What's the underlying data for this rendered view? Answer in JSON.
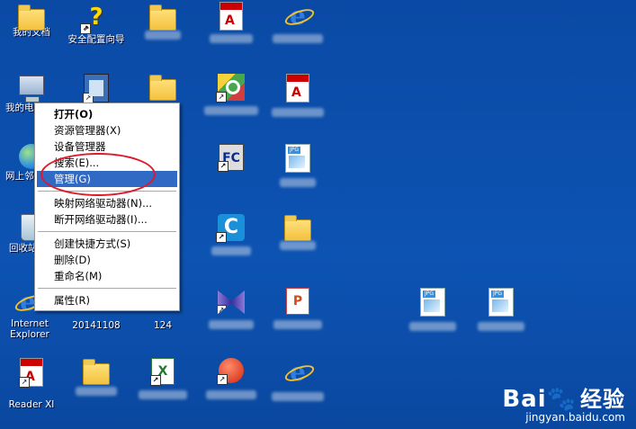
{
  "desktop": {
    "icons": [
      {
        "label": "我的文档"
      },
      {
        "label": "安全配置向导"
      },
      {
        "label": "网上邻居"
      },
      {
        "label": "回收站"
      },
      {
        "label": "Internet Explorer"
      },
      {
        "label": "20141108"
      },
      {
        "label": "124"
      },
      {
        "label": "Reader XI"
      },
      {
        "label": "我的电脑"
      }
    ]
  },
  "context_menu": {
    "items": [
      {
        "label": "打开(O)"
      },
      {
        "label": "资源管理器(X)"
      },
      {
        "label": "设备管理器"
      },
      {
        "label": "搜索(E)..."
      },
      {
        "label": "管理(G)"
      },
      {
        "label": "映射网络驱动器(N)..."
      },
      {
        "label": "断开网络驱动器(I)..."
      },
      {
        "label": "创建快捷方式(S)"
      },
      {
        "label": "删除(D)"
      },
      {
        "label": "重命名(M)"
      },
      {
        "label": "属性(R)"
      }
    ]
  },
  "watermark": {
    "brand": "Bai",
    "brand_suffix": "经验",
    "url": "jingyan.baidu.com"
  }
}
